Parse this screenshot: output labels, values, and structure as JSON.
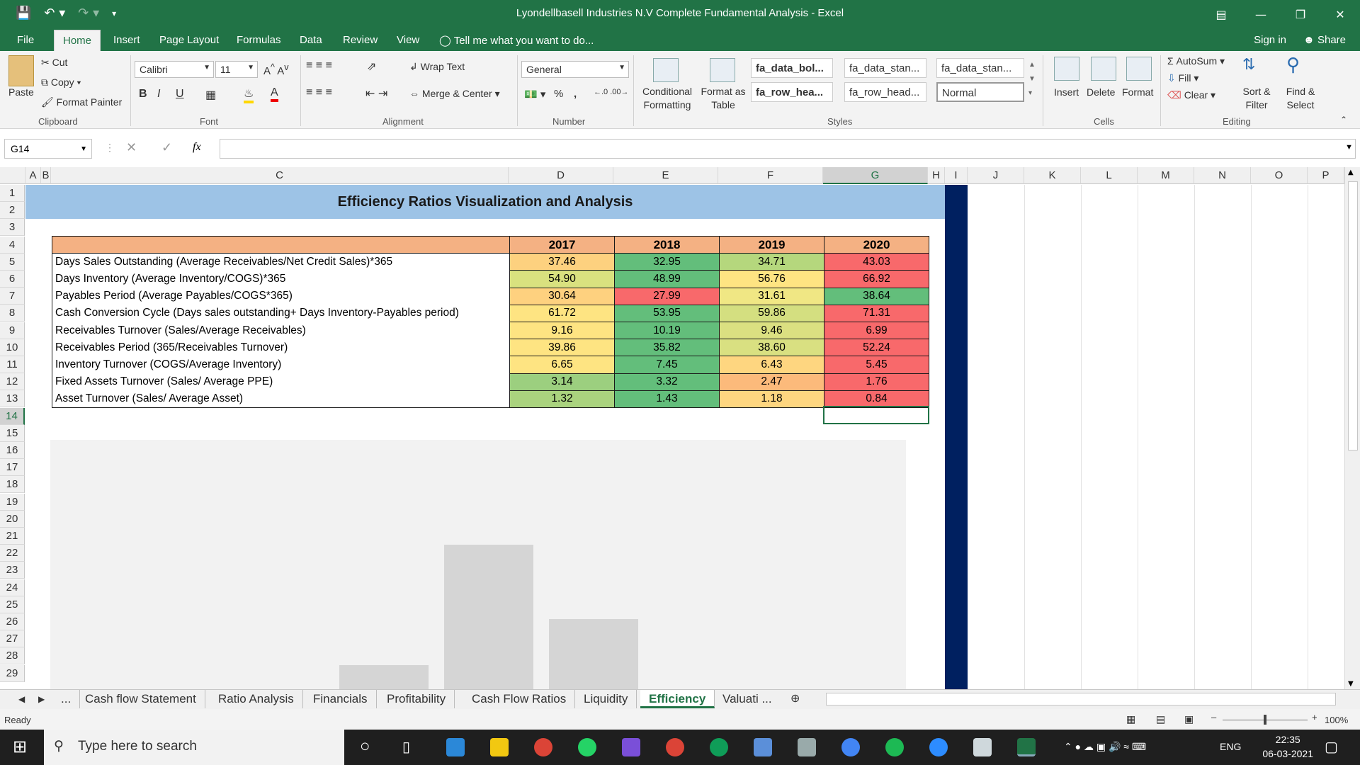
{
  "window": {
    "title": "Lyondellbasell Industries N.V Complete Fundamental Analysis  -  Excel"
  },
  "ribbon_tabs": [
    "File",
    "Home",
    "Insert",
    "Page Layout",
    "Formulas",
    "Data",
    "Review",
    "View"
  ],
  "tell_me": "Tell me what you want to do...",
  "sign_in": "Sign in",
  "share": "Share",
  "clipboard": {
    "paste": "Paste",
    "cut": "Cut",
    "copy": "Copy",
    "format_painter": "Format Painter",
    "group": "Clipboard"
  },
  "font": {
    "name": "Calibri",
    "size": "11",
    "bold": "B",
    "italic": "I",
    "underline": "U",
    "group": "Font"
  },
  "alignment": {
    "wrap_text": "Wrap Text",
    "merge_center": "Merge & Center",
    "group": "Alignment"
  },
  "number": {
    "format": "General",
    "percent": "%",
    "comma": ",",
    "group": "Number"
  },
  "styles": {
    "conditional": "Conditional Formatting",
    "format_as_table": "Format as Table",
    "cells": [
      "fa_data_bol...",
      "fa_data_stan...",
      "fa_data_stan...",
      "fa_row_hea...",
      "fa_row_head...",
      "Normal"
    ],
    "group": "Styles"
  },
  "cells_group": {
    "insert": "Insert",
    "delete": "Delete",
    "format": "Format",
    "group": "Cells"
  },
  "editing": {
    "autosum": "AutoSum",
    "fill": "Fill",
    "clear": "Clear",
    "sort_filter": "Sort & Filter",
    "find_select": "Find & Select",
    "group": "Editing"
  },
  "formula_bar": {
    "name_box": "G14",
    "fx": "fx",
    "formula": ""
  },
  "columns": [
    "A",
    "B",
    "C",
    "D",
    "E",
    "F",
    "G",
    "H",
    "I",
    "J",
    "K",
    "L",
    "M",
    "N",
    "O",
    "P"
  ],
  "rows": [
    "1",
    "2",
    "3",
    "4",
    "5",
    "6",
    "7",
    "8",
    "9",
    "10",
    "11",
    "12",
    "13",
    "14",
    "15",
    "16",
    "17",
    "18",
    "19",
    "20",
    "21",
    "22",
    "23",
    "24",
    "25",
    "26",
    "27",
    "28",
    "29"
  ],
  "sheet": {
    "banner": "Efficiency Ratios Visualization and Analysis",
    "years": [
      "2017",
      "2018",
      "2019",
      "2020"
    ],
    "rows": [
      {
        "label": "Days Sales Outstanding (Average Receivables/Net Credit Sales)*365",
        "values": [
          "37.46",
          "32.95",
          "34.71",
          "43.03"
        ],
        "colors": [
          "#fdd17f",
          "#63be7b",
          "#b5d77d",
          "#f8696b"
        ]
      },
      {
        "label": "Days Inventory  (Average Inventory/COGS)*365",
        "values": [
          "54.90",
          "48.99",
          "56.76",
          "66.92"
        ],
        "colors": [
          "#d9e17f",
          "#63be7b",
          "#fee482",
          "#f8696b"
        ]
      },
      {
        "label": "Payables Period (Average Payables/COGS*365)",
        "values": [
          "30.64",
          "27.99",
          "31.61",
          "38.64"
        ],
        "colors": [
          "#fed17f",
          "#f8696b",
          "#f0e784",
          "#63be7b"
        ]
      },
      {
        "label": "Cash Conversion Cycle (Days sales outstanding+ Days Inventory-Payables period)",
        "values": [
          "61.72",
          "53.95",
          "59.86",
          "71.31"
        ],
        "colors": [
          "#fee482",
          "#63be7b",
          "#d4df80",
          "#f8696b"
        ]
      },
      {
        "label": "Receivables Turnover (Sales/Average Receivables)",
        "values": [
          "9.16",
          "10.19",
          "9.46",
          "6.99"
        ],
        "colors": [
          "#fee482",
          "#63be7b",
          "#dbe081",
          "#f8696b"
        ]
      },
      {
        "label": "Receivables Period (365/Receivables Turnover)",
        "values": [
          "39.86",
          "35.82",
          "38.60",
          "52.24"
        ],
        "colors": [
          "#fee482",
          "#63be7b",
          "#d9e081",
          "#f8696b"
        ]
      },
      {
        "label": "Inventory Turnover (COGS/Average Inventory)",
        "values": [
          "6.65",
          "7.45",
          "6.43",
          "5.45"
        ],
        "colors": [
          "#fee482",
          "#63be7b",
          "#fed680",
          "#f8696b"
        ]
      },
      {
        "label": "Fixed Assets Turnover (Sales/ Average PPE)",
        "values": [
          "3.14",
          "3.32",
          "2.47",
          "1.76"
        ],
        "colors": [
          "#9ccf7f",
          "#63be7b",
          "#fcba7b",
          "#f8696b"
        ]
      },
      {
        "label": "Asset Turnover (Sales/ Average Asset)",
        "values": [
          "1.32",
          "1.43",
          "1.18",
          "0.84"
        ],
        "colors": [
          "#aad37e",
          "#63be7b",
          "#fed680",
          "#f8696b"
        ]
      }
    ]
  },
  "sheet_tabs": [
    "...",
    "Cash flow Statement",
    "Ratio Analysis",
    "Financials",
    "Profitability",
    "Cash Flow Ratios",
    "Liquidity",
    "Efficiency",
    "Valuati ..."
  ],
  "status": {
    "ready": "Ready",
    "zoom": "100%"
  },
  "taskbar": {
    "search": "Type here to search",
    "time": "22:35",
    "date": "06-03-2021",
    "lang": "ENG"
  },
  "colors": {
    "excel_green": "#217346",
    "banner_blue": "#9dc3e6",
    "header_orange": "#f4b183",
    "navy": "#002060"
  }
}
